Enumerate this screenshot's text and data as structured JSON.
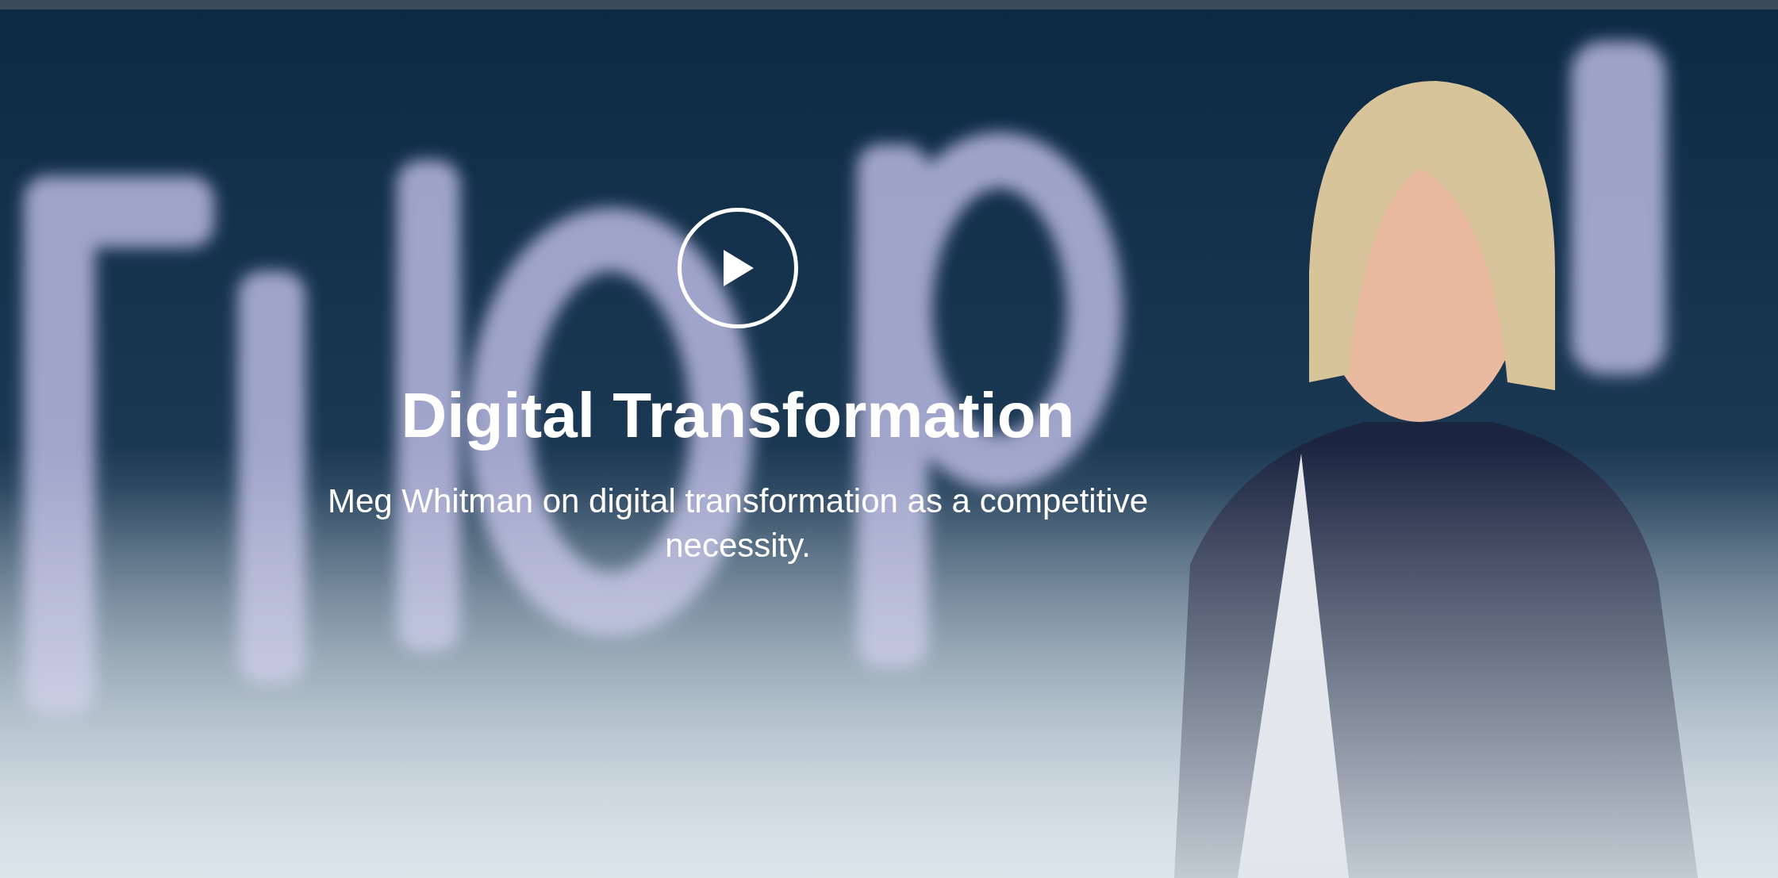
{
  "hero": {
    "title": "Digital Transformation",
    "subtitle": "Meg Whitman on digital transformation as a competitive necessity."
  }
}
